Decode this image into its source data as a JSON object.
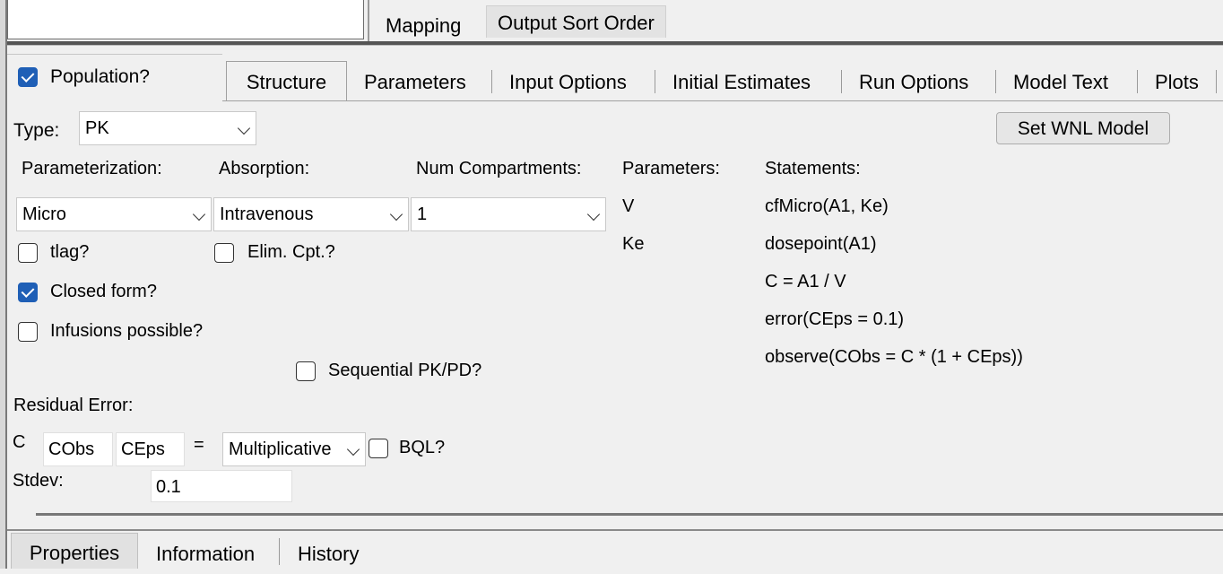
{
  "top": {
    "tabs": [
      "Mapping",
      "Output Sort Order"
    ]
  },
  "population": {
    "label": "Population?",
    "checked": true
  },
  "tabs": [
    "Structure",
    "Parameters",
    "Input Options",
    "Initial Estimates",
    "Run Options",
    "Model Text",
    "Plots"
  ],
  "type": {
    "label": "Type:",
    "value": "PK"
  },
  "set_wnl_button": "Set WNL Model",
  "parameterization": {
    "label": "Parameterization:",
    "value": "Micro"
  },
  "absorption": {
    "label": "Absorption:",
    "value": "Intravenous"
  },
  "num_compartments": {
    "label": "Num Compartments:",
    "value": "1"
  },
  "checkboxes": {
    "tlag": {
      "label": "tlag?",
      "checked": false
    },
    "elim_cpt": {
      "label": "Elim. Cpt.?",
      "checked": false
    },
    "closed_form": {
      "label": "Closed form?",
      "checked": true
    },
    "infusions": {
      "label": "Infusions possible?",
      "checked": false
    },
    "sequential": {
      "label": "Sequential PK/PD?",
      "checked": false
    },
    "bql": {
      "label": "BQL?",
      "checked": false
    }
  },
  "parameters": {
    "label": "Parameters:",
    "items": [
      "V",
      "Ke"
    ]
  },
  "statements": {
    "label": "Statements:",
    "items": [
      "cfMicro(A1, Ke)",
      "dosepoint(A1)",
      "C = A1 / V",
      "error(CEps = 0.1)",
      "observe(CObs = C * (1 + CEps))"
    ]
  },
  "residual": {
    "label": "Residual Error:",
    "var": "C",
    "obs": "CObs",
    "eps": "CEps",
    "equals": "=",
    "type": "Multiplicative",
    "stdev_label": "Stdev:",
    "stdev_value": "0.1"
  },
  "bottom_tabs": [
    "Properties",
    "Information",
    "History"
  ],
  "colors": {
    "accent": "#1f5fb6",
    "background": "#f0f0f0"
  }
}
